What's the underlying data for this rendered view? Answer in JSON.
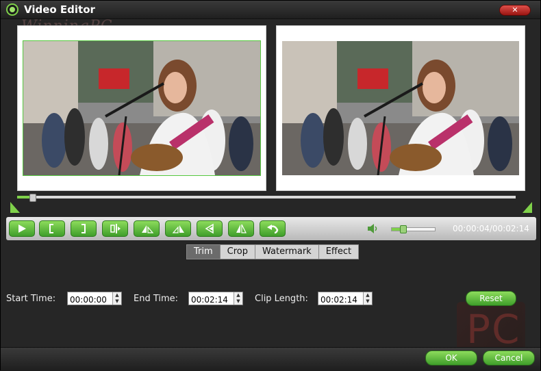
{
  "window": {
    "title": "Video Editor",
    "close_label": "✕"
  },
  "watermark": {
    "text": "WinningPC",
    "logo_text": "PC"
  },
  "playback": {
    "timeline_progress": 0.03,
    "volume_level": 0.25,
    "time": "00:00:04/00:02:14"
  },
  "toolbar": {
    "buttons": [
      {
        "name": "play",
        "icon": "play-icon"
      },
      {
        "name": "set-start",
        "icon": "bracket-left-icon"
      },
      {
        "name": "set-end",
        "icon": "bracket-right-icon"
      },
      {
        "name": "split",
        "icon": "split-icon"
      },
      {
        "name": "rotate-left",
        "icon": "rotate-left-icon"
      },
      {
        "name": "rotate-right",
        "icon": "rotate-right-icon"
      },
      {
        "name": "flip-horizontal",
        "icon": "flip-horizontal-icon"
      },
      {
        "name": "flip-vertical",
        "icon": "flip-vertical-icon"
      },
      {
        "name": "undo",
        "icon": "undo-icon"
      }
    ]
  },
  "tabs": [
    {
      "label": "Trim",
      "active": true
    },
    {
      "label": "Crop",
      "active": false
    },
    {
      "label": "Watermark",
      "active": false
    },
    {
      "label": "Effect",
      "active": false
    }
  ],
  "trim": {
    "start_label": "Start Time:",
    "start_value": "00:00:00",
    "end_label": "End Time:",
    "end_value": "00:02:14",
    "length_label": "Clip Length:",
    "length_value": "00:02:14",
    "reset_label": "Reset"
  },
  "footer": {
    "ok_label": "OK",
    "cancel_label": "Cancel"
  },
  "colors": {
    "accent": "#7fd14a",
    "background": "#262626"
  }
}
